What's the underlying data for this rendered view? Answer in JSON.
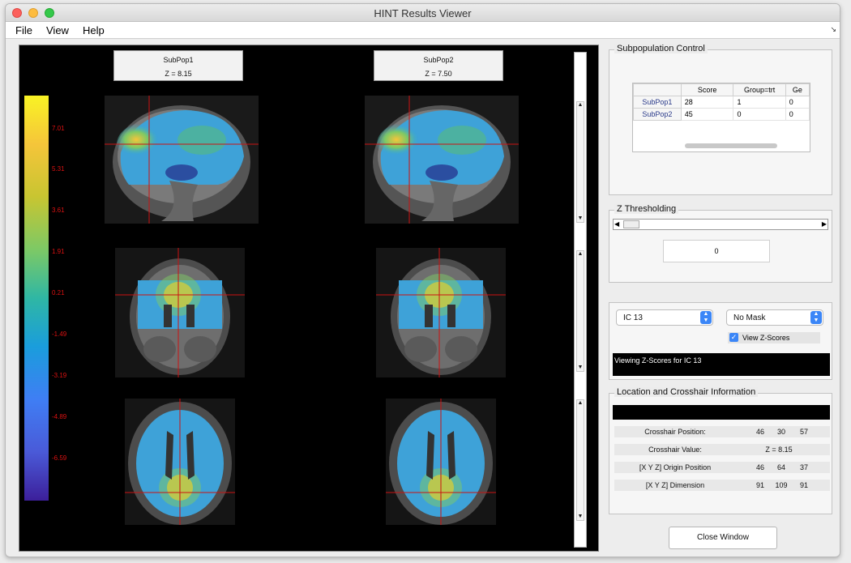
{
  "window": {
    "title": "HINT Results Viewer"
  },
  "menu": {
    "file": "File",
    "view": "View",
    "help": "Help"
  },
  "viewer": {
    "subpops": [
      {
        "name": "SubPop1",
        "z": "Z = 8.15"
      },
      {
        "name": "SubPop2",
        "z": "Z = 7.50"
      }
    ],
    "colorbar_labels": [
      "7.01",
      "5.31",
      "3.61",
      "1.91",
      "0.21",
      "-1.49",
      "-3.19",
      "-4.89",
      "-6.59"
    ],
    "colors": {
      "crosshair": "#cc1111",
      "background": "#000000"
    }
  },
  "subpop_control": {
    "title": "Subpopulation Control",
    "columns": [
      "Score",
      "Group=trt",
      "Ge"
    ],
    "rows": [
      {
        "label": "SubPop1",
        "cells": [
          "28",
          "1",
          "0"
        ]
      },
      {
        "label": "SubPop2",
        "cells": [
          "45",
          "0",
          "0"
        ]
      }
    ]
  },
  "z_threshold": {
    "title": "Z Thresholding",
    "value": "0"
  },
  "controls": {
    "ic_select": "IC 13",
    "mask_select": "No Mask",
    "view_z_label": "View Z-Scores",
    "view_z_checked": true,
    "status": "Viewing Z-Scores for IC 13"
  },
  "location": {
    "title": "Location and Crosshair Information",
    "rows": [
      {
        "label": "Crosshair Position:",
        "values": [
          "46",
          "30",
          "57"
        ]
      },
      {
        "label": "Crosshair Value:",
        "values": [
          "Z = 8.15"
        ]
      },
      {
        "label": "[X Y Z] Origin Position",
        "values": [
          "46",
          "64",
          "37"
        ]
      },
      {
        "label": "[X Y Z] Dimension",
        "values": [
          "91",
          "109",
          "91"
        ]
      }
    ]
  },
  "close_button": "Close Window"
}
